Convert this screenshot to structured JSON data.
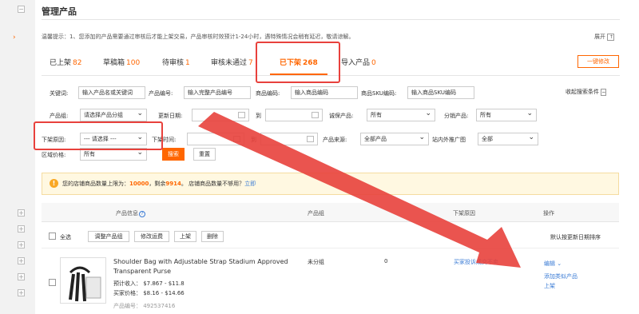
{
  "header": {
    "title": "管理产品",
    "expand_label": "展开"
  },
  "notice": "温馨提示：1、您添加的产品需要通过审核后才能上架交易，产品审核时效预计1-24小时，遇特殊情况会稍有延迟，敬请谅解。",
  "tabs": [
    {
      "label": "已上架",
      "count": "82"
    },
    {
      "label": "草稿箱",
      "count": "100"
    },
    {
      "label": "待审核",
      "count": "1"
    },
    {
      "label": "审核未通过",
      "count": "7"
    },
    {
      "label": "已下架",
      "count": "268"
    },
    {
      "label": "导入产品",
      "count": "0"
    }
  ],
  "batch_edit_label": "一键修改",
  "filters": {
    "keyword_label": "关键词:",
    "keyword_placeholder": "输入产品名或关键词",
    "product_code_label": "产品编号:",
    "product_code_placeholder": "输入完整产品编号",
    "sku_code_label": "商品编码:",
    "sku_code_placeholder": "输入商品编码",
    "sku_id_label": "商品SKU编码:",
    "sku_id_placeholder": "输入商品SKU编码",
    "collapse_label": "收起搜索条件",
    "group_label": "产品组:",
    "group_value": "请选择产品分组",
    "update_date_label": "更新日期:",
    "to_label": "到",
    "guarantee_label": "诚保产品:",
    "guarantee_value": "所有",
    "distribute_label": "分销产品:",
    "distribute_value": "所有",
    "offline_reason_label": "下架原因:",
    "offline_reason_value": "--- 请选择 ---",
    "offline_time_label": "下架时间:",
    "to_label2": "到",
    "source_label": "产品来源:",
    "source_value": "全部产品",
    "promo_label": "站内外推广图",
    "promo_value": "全部",
    "price_label": "区域价格:",
    "price_value": "所有",
    "search_label": "搜索",
    "reset_label": "重置"
  },
  "warning": {
    "prefix": "您的店铺商品数量上限为：",
    "limit": "10000",
    "mid": "，剩余",
    "remaining": "9914",
    "suffix": "。 店铺商品数量不够用？",
    "link": "立即"
  },
  "table": {
    "col_info": "产品信息",
    "col_group": "产品组",
    "col_reason": "下架原因",
    "col_action": "操作",
    "select_all": "全选",
    "actions": [
      "调整产品组",
      "修改运费",
      "上架",
      "删除"
    ],
    "sort_label": "默认按更新日期排序"
  },
  "product": {
    "title_line1": "Shoulder Bag with Adjustable Strap Stadium Approved",
    "title_line2": "Transparent Purse",
    "expected_income": "预计收入： $7.867 - $11.8",
    "buyer_price": "买家价格： $8.16 - $14.66",
    "code": "产品编号： 492537416",
    "group": "未分组",
    "stock": "0",
    "reason": "买家投诉成交不卖",
    "edit": "编辑",
    "add_similar": "添加类似产品",
    "shelve": "上架"
  },
  "colors": {
    "accent": "#ff6600",
    "annotation_red": "#e8413c",
    "link": "#3a7bd5"
  }
}
